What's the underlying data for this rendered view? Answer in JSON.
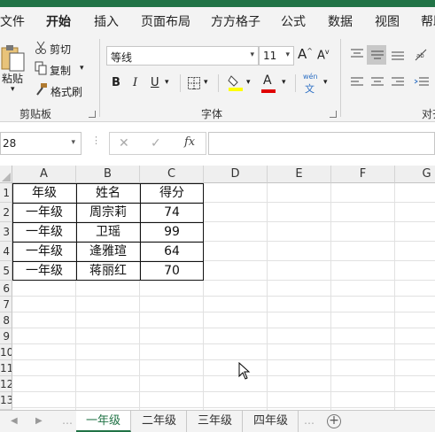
{
  "ribbon_tabs": [
    {
      "label": "文件",
      "active": false
    },
    {
      "label": "开始",
      "active": true
    },
    {
      "label": "插入",
      "active": false
    },
    {
      "label": "页面布局",
      "active": false
    },
    {
      "label": "方方格子",
      "active": false
    },
    {
      "label": "公式",
      "active": false
    },
    {
      "label": "数据",
      "active": false
    },
    {
      "label": "视图",
      "active": false
    },
    {
      "label": "帮助",
      "active": false
    }
  ],
  "clipboard": {
    "paste_label": "粘贴",
    "cut_label": "剪切",
    "copy_label": "复制",
    "format_painter_label": "格式刷",
    "group_label": "剪贴板"
  },
  "font": {
    "font_name": "等线",
    "font_size": "11",
    "group_label": "字体",
    "bold": "B",
    "italic": "I",
    "underline": "U",
    "grow": "A",
    "shrink": "A",
    "font_color_letter": "A",
    "phonetic_top": "wén",
    "phonetic_bottom": "文"
  },
  "alignment": {
    "group_label": "对齐"
  },
  "colors": {
    "brand": "#217346",
    "highlight": "#ffff00",
    "font_color": "#e00000"
  },
  "formula_bar": {
    "name_box": "28",
    "fx_label": "fx",
    "cancel_symbol": "✕",
    "enter_symbol": "✓",
    "formula_value": ""
  },
  "sheet": {
    "columns": [
      "A",
      "B",
      "C",
      "D",
      "E",
      "F",
      "G"
    ],
    "row_numbers": [
      "1",
      "2",
      "3",
      "4",
      "5",
      "6",
      "7",
      "8",
      "9",
      "10",
      "11",
      "12",
      "13"
    ],
    "rows": [
      [
        "年级",
        "姓名",
        "得分"
      ],
      [
        "一年级",
        "周宗莉",
        "74"
      ],
      [
        "一年级",
        "卫瑶",
        "99"
      ],
      [
        "一年级",
        "逄雅瑄",
        "64"
      ],
      [
        "一年级",
        "蒋丽红",
        "70"
      ]
    ]
  },
  "sheet_tabs": [
    {
      "label": "一年级",
      "active": true
    },
    {
      "label": "二年级",
      "active": false
    },
    {
      "label": "三年级",
      "active": false
    },
    {
      "label": "四年级",
      "active": false
    }
  ],
  "add_sheet_symbol": "+"
}
